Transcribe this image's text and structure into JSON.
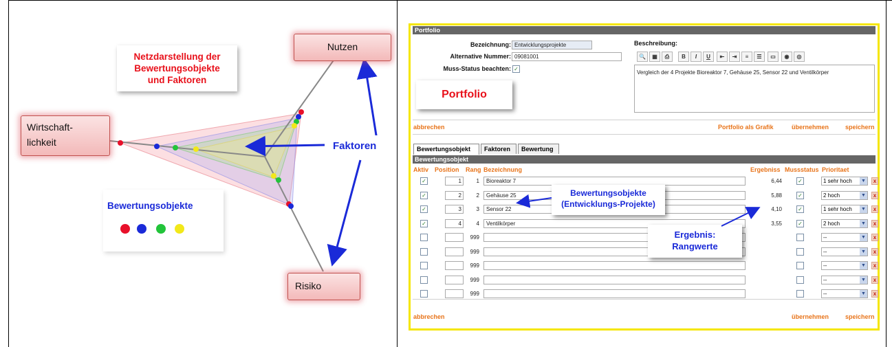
{
  "diagram": {
    "title_lines": [
      "Netzdarstellung der",
      "Bewertungsobjekte",
      "und Faktoren"
    ],
    "nodes": {
      "top": "Nutzen",
      "left_line1": "Wirtschaft-",
      "left_line2": "lichkeit",
      "bottom": "Risiko"
    },
    "factors_label": "Faktoren",
    "objects_label": "Bewertungsobjekte",
    "dot_colors": [
      "#e8102a",
      "#1a2ad8",
      "#22c43a",
      "#f2e81a"
    ]
  },
  "app": {
    "header_title": "Portfolio",
    "form": {
      "bezeichnung_label": "Bezeichnung:",
      "bezeichnung_value": "Entwicklungsprojekte",
      "alt_nummer_label": "Alternative Nummer:",
      "alt_nummer_value": "09081001",
      "muss_status_label": "Muss-Status beachten:",
      "beschreibung_label": "Beschreibung:",
      "beschreibung_value": "Vergleich der 4 Projekte Bioreaktor 7, Gehäuse 25, Sensor 22 und Ventilkörper",
      "portfolio_callout": "Portfolio"
    },
    "actions_top": {
      "abbrechen": "abbrechen",
      "grafik": "Portfolio als Grafik",
      "uebernehmen": "übernehmen",
      "speichern": "speichern"
    },
    "tabs": [
      "Bewertungsobjekt",
      "Faktoren",
      "Bewertung"
    ],
    "section_title": "Bewertungsobjekt",
    "columns": [
      "Aktiv",
      "Position",
      "Rang",
      "Bezeichnung",
      "Ergebniss",
      "Mussstatus",
      "Prioritaet"
    ],
    "rows": [
      {
        "aktiv": true,
        "position": "1",
        "rang": "1",
        "name": "Bioreaktor 7",
        "ergebnis": "6,44",
        "muss": true,
        "prio": "1 sehr hoch"
      },
      {
        "aktiv": true,
        "position": "2",
        "rang": "2",
        "name": "Gehäuse 25",
        "ergebnis": "5,88",
        "muss": true,
        "prio": "2 hoch"
      },
      {
        "aktiv": true,
        "position": "3",
        "rang": "3",
        "name": "Sensor 22",
        "ergebnis": "4,10",
        "muss": true,
        "prio": "1 sehr hoch"
      },
      {
        "aktiv": true,
        "position": "4",
        "rang": "4",
        "name": "Ventilkörper",
        "ergebnis": "3,55",
        "muss": true,
        "prio": "2 hoch"
      },
      {
        "aktiv": false,
        "position": "",
        "rang": "999",
        "name": "",
        "ergebnis": "",
        "muss": false,
        "prio": "--"
      },
      {
        "aktiv": false,
        "position": "",
        "rang": "999",
        "name": "",
        "ergebnis": "",
        "muss": false,
        "prio": "--"
      },
      {
        "aktiv": false,
        "position": "",
        "rang": "999",
        "name": "",
        "ergebnis": "",
        "muss": false,
        "prio": "--"
      },
      {
        "aktiv": false,
        "position": "",
        "rang": "999",
        "name": "",
        "ergebnis": "",
        "muss": false,
        "prio": "--"
      },
      {
        "aktiv": false,
        "position": "",
        "rang": "999",
        "name": "",
        "ergebnis": "",
        "muss": false,
        "prio": "--"
      }
    ],
    "actions_bottom": {
      "abbrechen": "abbrechen",
      "uebernehmen": "übernehmen",
      "speichern": "speichern"
    },
    "callouts": {
      "objects_line1": "Bewertungsobjekte",
      "objects_line2": "(Entwicklungs-Projekte)",
      "result_line1": "Ergebnis:",
      "result_line2": "Rangwerte"
    },
    "check_mark": "✓",
    "delete_mark": "x",
    "select_arrow": "▼",
    "toolbar_icons": [
      "preview-icon",
      "template-icon",
      "print-icon",
      "bold-icon",
      "italic-icon",
      "underline-icon",
      "outdent-icon",
      "indent-icon",
      "ordered-list-icon",
      "unordered-list-icon",
      "table-icon",
      "link-icon",
      "unlink-icon"
    ],
    "toolbar_glyphs": [
      "🔍",
      "▦",
      "⎙",
      "B",
      "I",
      "U",
      "⇤",
      "⇥",
      "≡",
      "☰",
      "▭",
      "◉",
      "◎"
    ]
  }
}
